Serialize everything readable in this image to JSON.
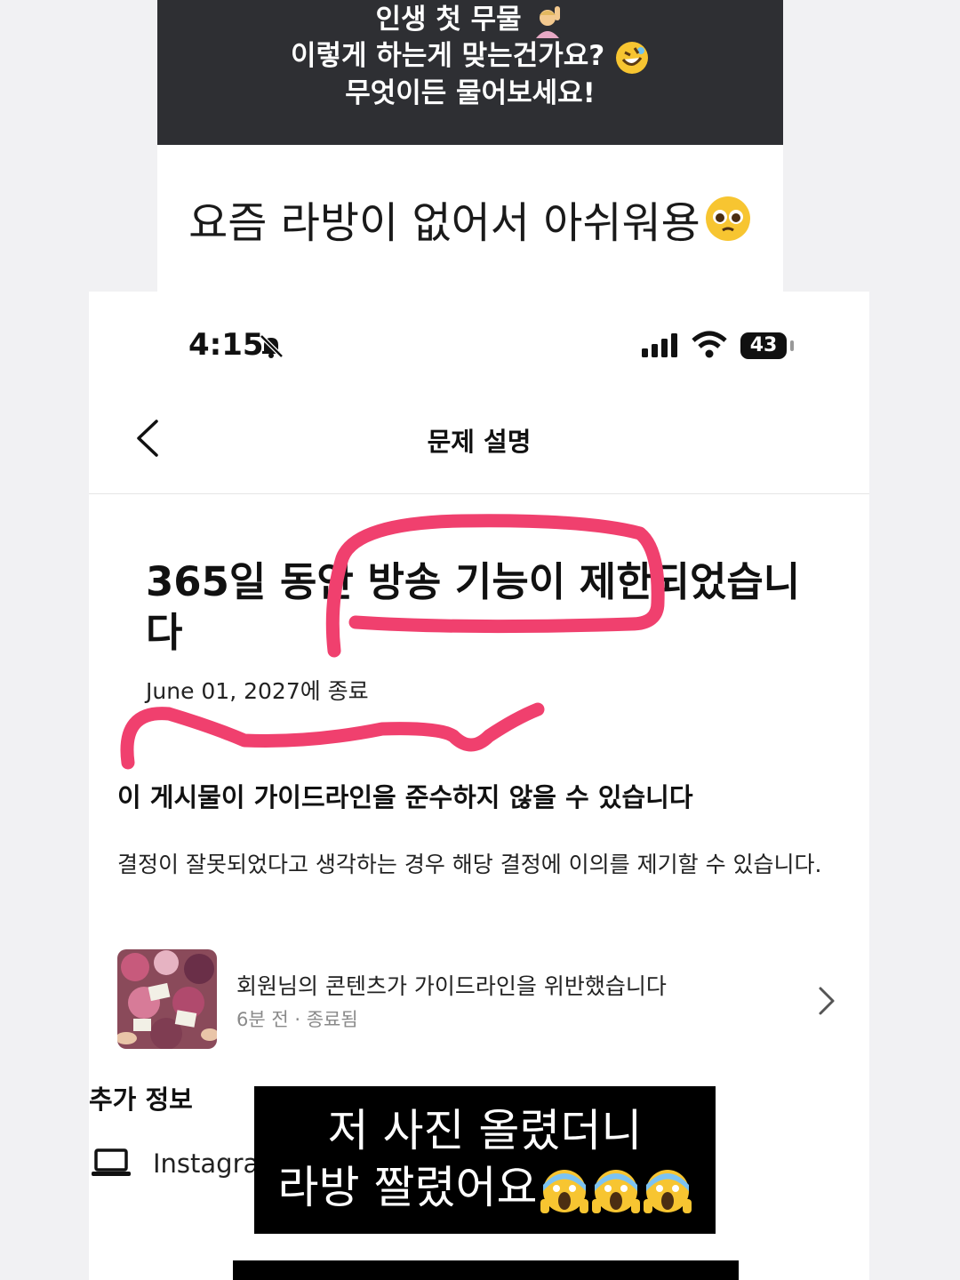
{
  "question_sticker": {
    "line1": "인생 첫 무물",
    "line2": "이렇게 하는게 맞는건가요?",
    "line3": "무엇이든 물어보세요!"
  },
  "answer_card": {
    "text": "요즘 라방이 없어서 아쉬워용"
  },
  "status_bar": {
    "time": "4:15",
    "battery": "43"
  },
  "nav": {
    "title": "문제 설명"
  },
  "restriction": {
    "headline": "365일 동안 방송 기능이 제한되었습니다",
    "end_date": "June 01, 2027에 종료"
  },
  "guideline": {
    "title": "이 게시물이 가이드라인을 준수하지 않을 수 있습니다",
    "appeal_text": "결정이 잘못되었다고 생각하는 경우 해당 결정에 이의를 제기할 수 있습니다."
  },
  "notice_item": {
    "title": "회원님의 콘텐츠가 가이드라인을 위반했습니다",
    "meta": "6분 전 · 종료됨"
  },
  "extra_info": {
    "title": "추가 정보",
    "platform": "Instagram"
  },
  "caption_sticker": {
    "line1": "저 사진 올렸더니",
    "line2": "라방 짤렸어요"
  },
  "colors": {
    "highlight": "#f0406e",
    "sticker_bg": "#2e2f33"
  }
}
